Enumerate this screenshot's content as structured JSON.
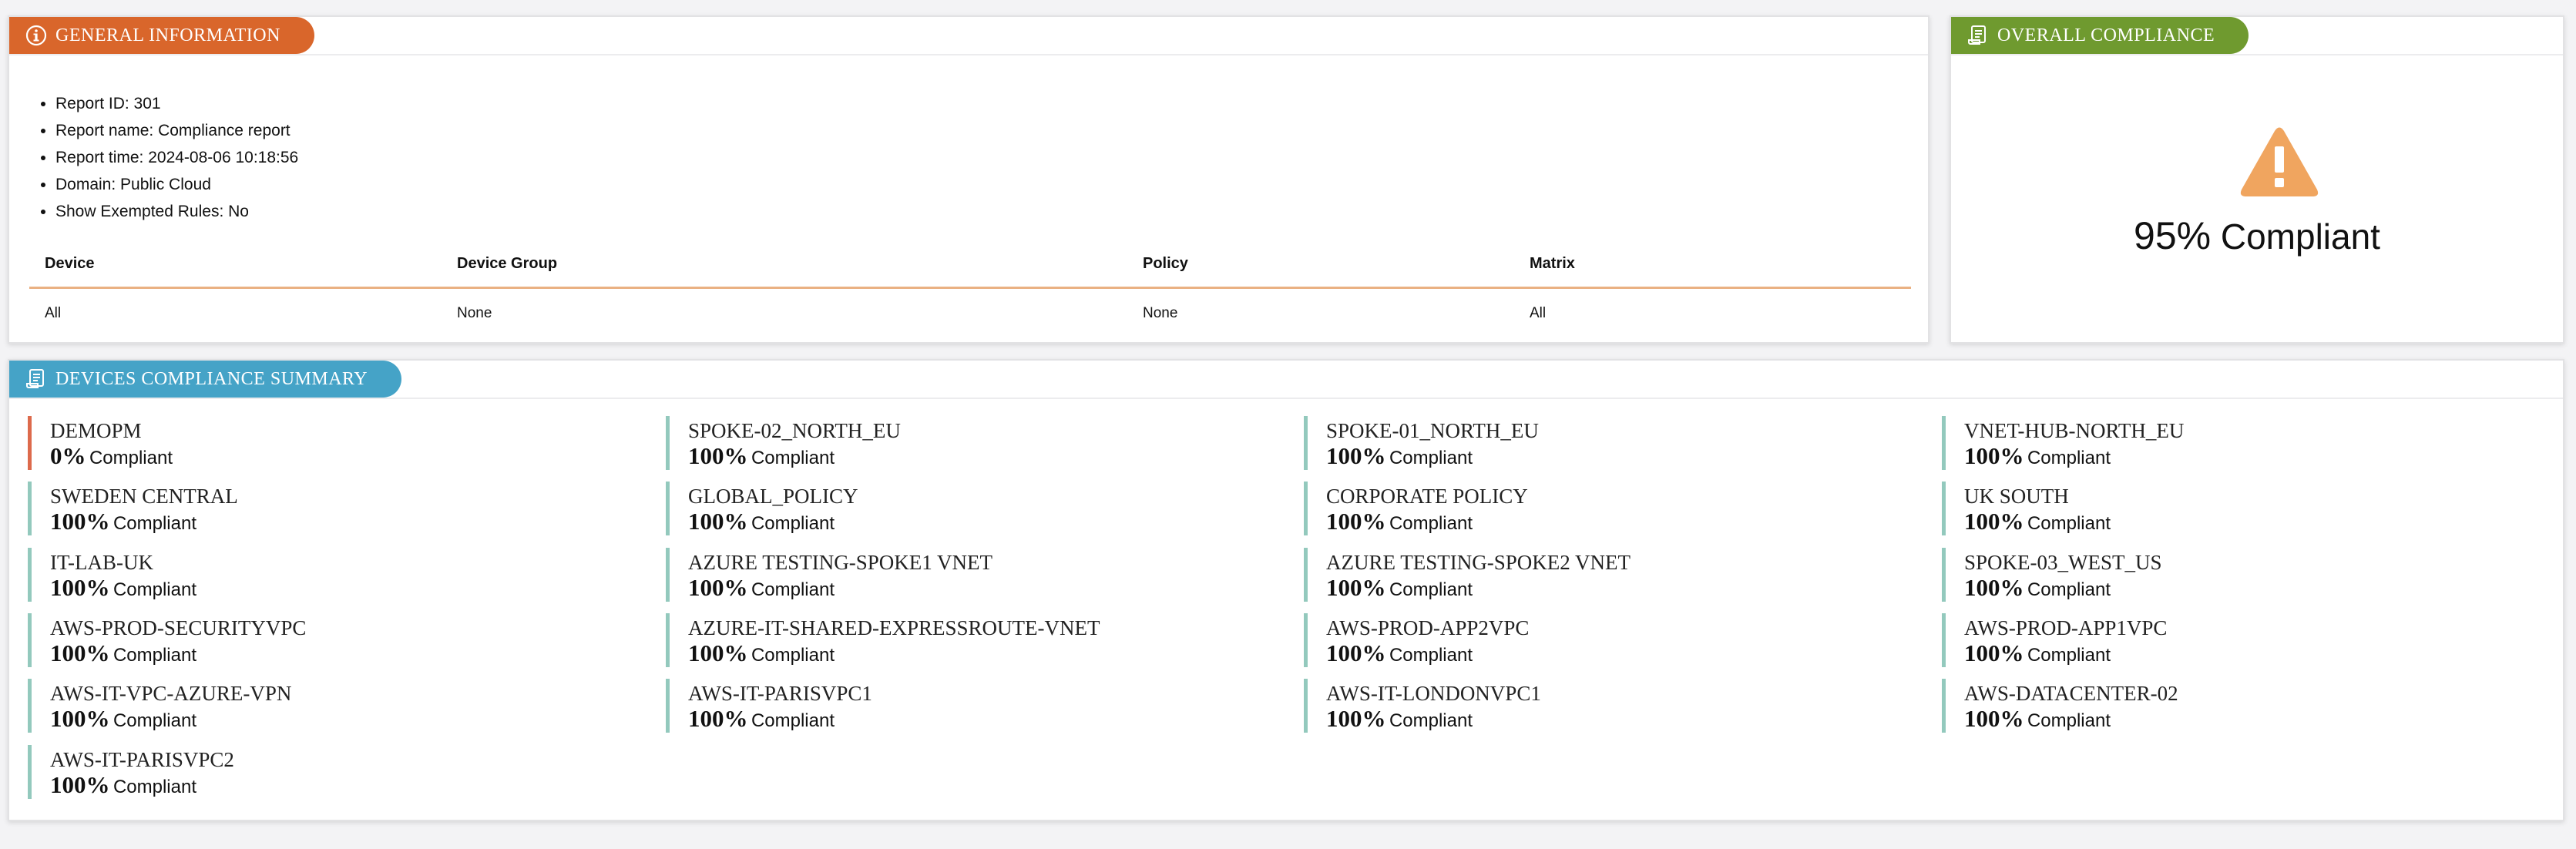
{
  "general": {
    "title": "GENERAL INFORMATION",
    "icon": "info-icon",
    "tab_color": "#d9662b",
    "items": [
      "Report ID: 301",
      "Report name: Compliance report",
      "Report time: 2024-08-06 10:18:56",
      "Domain: Public Cloud",
      "Show Exempted Rules: No"
    ],
    "table": {
      "headers": [
        "Device",
        "Device Group",
        "Policy",
        "Matrix"
      ],
      "row": [
        "All",
        "None",
        "None",
        "All"
      ]
    }
  },
  "overall": {
    "title": "OVERALL COMPLIANCE",
    "icon": "report-icon",
    "tab_color": "#6f9a2f",
    "status_icon": "warning-icon",
    "warning_color": "#f0a55f",
    "percent": "95%",
    "label": "Compliant"
  },
  "devices": {
    "title": "DEVICES COMPLIANCE SUMMARY",
    "icon": "report-icon",
    "tab_color": "#45a3c7",
    "compliant_label": "Compliant",
    "ok_color": "#93c9bd",
    "bad_color": "#dd6a4c",
    "items": [
      {
        "name": "DEMOPM",
        "percent": "0%",
        "status": "bad"
      },
      {
        "name": "SPOKE-02_NORTH_EU",
        "percent": "100%",
        "status": "ok"
      },
      {
        "name": "SPOKE-01_NORTH_EU",
        "percent": "100%",
        "status": "ok"
      },
      {
        "name": "VNET-HUB-NORTH_EU",
        "percent": "100%",
        "status": "ok"
      },
      {
        "name": "SWEDEN CENTRAL",
        "percent": "100%",
        "status": "ok"
      },
      {
        "name": "GLOBAL_POLICY",
        "percent": "100%",
        "status": "ok"
      },
      {
        "name": "CORPORATE POLICY",
        "percent": "100%",
        "status": "ok"
      },
      {
        "name": "UK SOUTH",
        "percent": "100%",
        "status": "ok"
      },
      {
        "name": "IT-LAB-UK",
        "percent": "100%",
        "status": "ok"
      },
      {
        "name": "AZURE TESTING-SPOKE1 VNET",
        "percent": "100%",
        "status": "ok"
      },
      {
        "name": "AZURE TESTING-SPOKE2 VNET",
        "percent": "100%",
        "status": "ok"
      },
      {
        "name": "SPOKE-03_WEST_US",
        "percent": "100%",
        "status": "ok"
      },
      {
        "name": "AWS-PROD-SECURITYVPC",
        "percent": "100%",
        "status": "ok"
      },
      {
        "name": "AZURE-IT-SHARED-EXPRESSROUTE-VNET",
        "percent": "100%",
        "status": "ok"
      },
      {
        "name": "AWS-PROD-APP2VPC",
        "percent": "100%",
        "status": "ok"
      },
      {
        "name": "AWS-PROD-APP1VPC",
        "percent": "100%",
        "status": "ok"
      },
      {
        "name": "AWS-IT-VPC-AZURE-VPN",
        "percent": "100%",
        "status": "ok"
      },
      {
        "name": "AWS-IT-PARISVPC1",
        "percent": "100%",
        "status": "ok"
      },
      {
        "name": "AWS-IT-LONDONVPC1",
        "percent": "100%",
        "status": "ok"
      },
      {
        "name": "AWS-DATACENTER-02",
        "percent": "100%",
        "status": "ok"
      },
      {
        "name": "AWS-IT-PARISVPC2",
        "percent": "100%",
        "status": "ok"
      }
    ]
  }
}
